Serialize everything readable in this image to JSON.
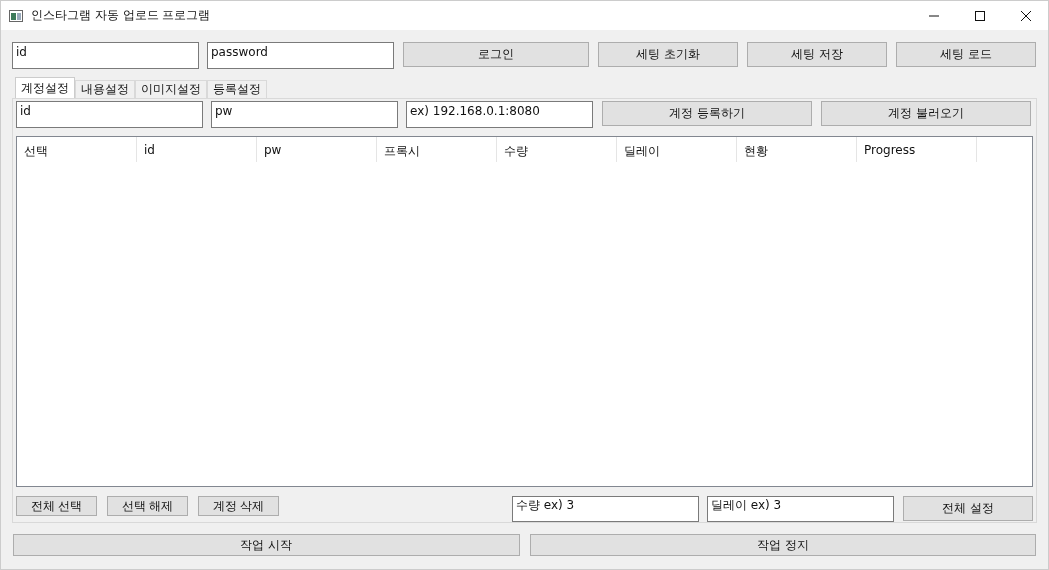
{
  "window": {
    "title": "인스타그램 자동 업로드 프로그램"
  },
  "login": {
    "id": "id",
    "password": "password",
    "buttons": [
      "로그인",
      "세팅 초기화",
      "세팅 저장",
      "세팅 로드"
    ]
  },
  "tabs": [
    {
      "label": "계정설정",
      "selected": true
    },
    {
      "label": "내용설정",
      "selected": false
    },
    {
      "label": "이미지설정",
      "selected": false
    },
    {
      "label": "등록설정",
      "selected": false
    }
  ],
  "account": {
    "id": "id",
    "pw": "pw",
    "proxy": "ex) 192.168.0.1:8080",
    "buttons": [
      "계정 등록하기",
      "계정 불러오기"
    ]
  },
  "table": {
    "columns": [
      "선택",
      "id",
      "pw",
      "프록시",
      "수량",
      "딜레이",
      "현황",
      "Progress"
    ]
  },
  "bottom": {
    "buttons": [
      "전체 선택",
      "선택 해제",
      "계정 삭제"
    ],
    "count": "수량 ex) 3",
    "delay": "딜레이 ex) 3",
    "apply": "전체 설정"
  },
  "actions": [
    "작업 시작",
    "작업 정지"
  ]
}
